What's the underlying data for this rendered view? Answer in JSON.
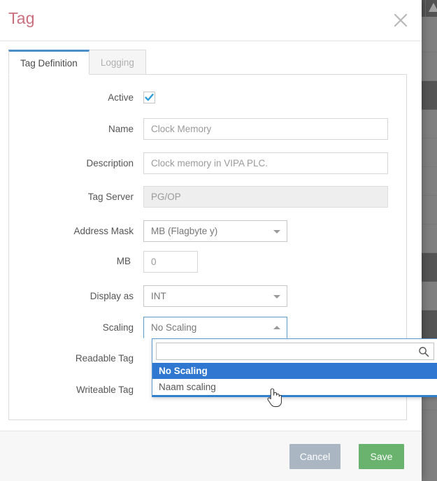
{
  "window": {
    "title": "Tag",
    "close_icon": "close-icon"
  },
  "tabs": [
    {
      "label": "Tag Definition",
      "active": true
    },
    {
      "label": "Logging",
      "active": false
    }
  ],
  "form": {
    "active": {
      "label": "Active",
      "checked": true,
      "icon": "checkmark-icon"
    },
    "name": {
      "label": "Name",
      "value": "Clock Memory",
      "placeholder": "Clock Memory"
    },
    "description": {
      "label": "Description",
      "value": "Clock memory in VIPA PLC.",
      "placeholder": "Clock memory in VIPA PLC."
    },
    "tag_server": {
      "label": "Tag Server",
      "value": "PG/OP",
      "disabled": true
    },
    "address_mask": {
      "label": "Address Mask",
      "value": "MB (Flagbyte y)",
      "caret": "chevron-down-icon"
    },
    "mb": {
      "label": "MB",
      "value": "0",
      "placeholder": "0"
    },
    "display_as": {
      "label": "Display as",
      "value": "INT",
      "caret": "chevron-down-icon"
    },
    "scaling": {
      "label": "Scaling",
      "value": "No Scaling",
      "caret": "chevron-up-icon"
    },
    "readable_tag": {
      "label": "Readable Tag"
    },
    "writeable_tag": {
      "label": "Writeable Tag"
    }
  },
  "dropdown": {
    "search_value": "",
    "search_placeholder": "",
    "search_icon": "search-icon",
    "options": [
      {
        "label": "No Scaling",
        "selected": true
      },
      {
        "label": "Naam scaling",
        "selected": false
      }
    ]
  },
  "footer": {
    "cancel_label": "Cancel",
    "save_label": "Save"
  },
  "colors": {
    "title": "#c9707f",
    "tab_active_border": "#4a8fc7",
    "dropdown_highlight": "#2f77d0",
    "save": "#6ab36f",
    "cancel": "#aab7c3",
    "checkbox": "#3a9ad9"
  }
}
